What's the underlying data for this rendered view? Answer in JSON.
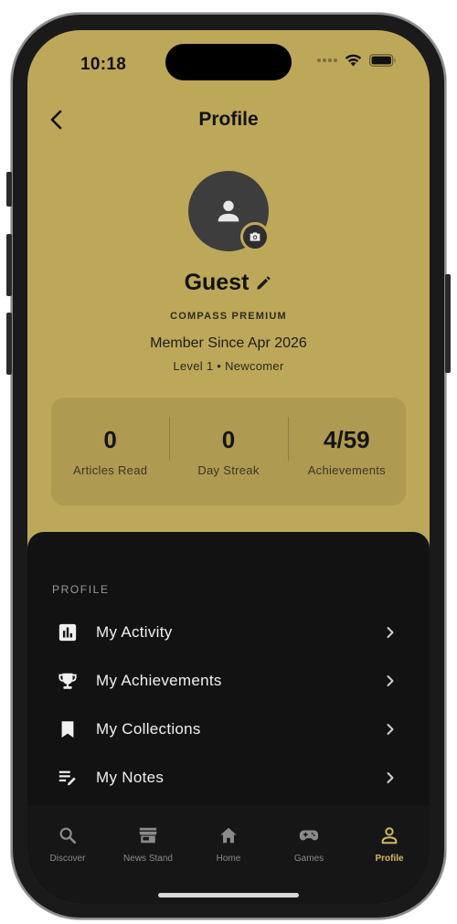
{
  "status_bar": {
    "time": "10:18"
  },
  "header": {
    "title": "Profile"
  },
  "profile": {
    "name": "Guest",
    "tier": "COMPASS PREMIUM",
    "member_since": "Member Since Apr 2026",
    "level": "Level 1 • Newcomer"
  },
  "stats": [
    {
      "value": "0",
      "label": "Articles Read"
    },
    {
      "value": "0",
      "label": "Day Streak"
    },
    {
      "value": "4/59",
      "label": "Achievements"
    }
  ],
  "section": {
    "label": "PROFILE"
  },
  "menu": [
    {
      "label": "My Activity",
      "icon": "bar-chart-icon"
    },
    {
      "label": "My Achievements",
      "icon": "trophy-icon"
    },
    {
      "label": "My Collections",
      "icon": "bookmark-icon"
    },
    {
      "label": "My Notes",
      "icon": "notes-edit-icon"
    }
  ],
  "tabs": [
    {
      "label": "Discover",
      "icon": "search-icon"
    },
    {
      "label": "News Stand",
      "icon": "storefront-icon"
    },
    {
      "label": "Home",
      "icon": "home-icon"
    },
    {
      "label": "Games",
      "icon": "gamepad-icon"
    },
    {
      "label": "Profile",
      "icon": "person-icon",
      "active": true
    }
  ],
  "colors": {
    "accent": "#BDA859",
    "stats_card": "#AE9A51",
    "sheet": "#121212",
    "active_tab": "#D2B960"
  }
}
